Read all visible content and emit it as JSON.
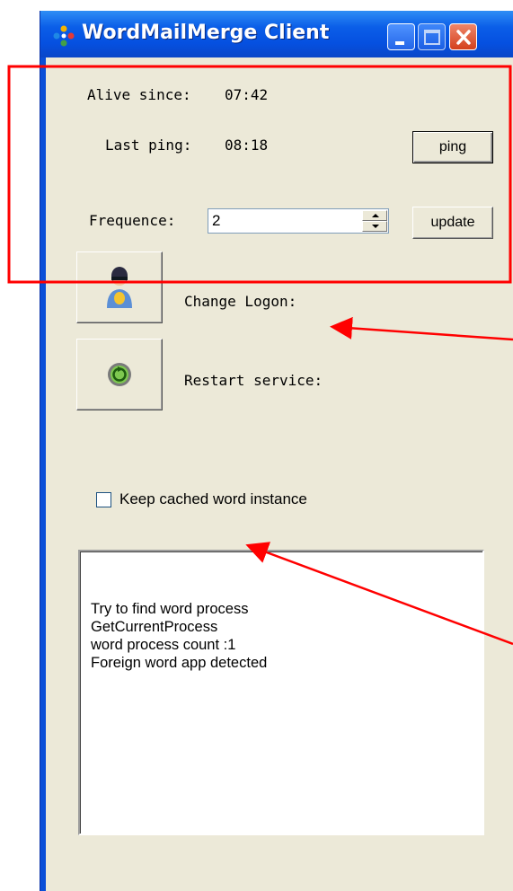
{
  "window": {
    "title": "WordMailMerge Client"
  },
  "status": {
    "alive_label": "Alive since:",
    "alive_value": "07:42",
    "ping_label": "Last ping:",
    "ping_value": "08:18"
  },
  "buttons": {
    "ping": "ping",
    "update": "update"
  },
  "frequence": {
    "label": "Frequence:",
    "value": "2"
  },
  "actions": {
    "change_logon": "Change Logon:",
    "restart_service": "Restart service:"
  },
  "options": {
    "keep_cached": "Keep cached word instance",
    "keep_cached_checked": false
  },
  "log": {
    "lines": [
      "Try to find word process",
      "GetCurrentProcess",
      "word process count :1",
      "Foreign word app detected"
    ]
  },
  "colors": {
    "annotation": "#ff0000",
    "titlebar": "#0a4fd8",
    "client_bg": "#ece9d8"
  }
}
